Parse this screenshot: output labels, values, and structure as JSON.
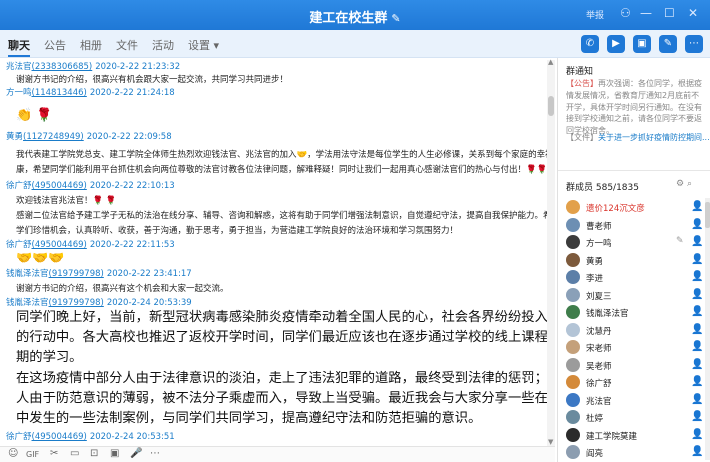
{
  "window": {
    "title": "建工在校生群",
    "edit_icon": "pencil-icon",
    "vip_label": "举报"
  },
  "tabs": [
    "聊天",
    "公告",
    "相册",
    "文件",
    "活动",
    "设置 ▾"
  ],
  "colors": {
    "accent": "#1f78d6",
    "link": "#1a7cc9",
    "red_name": "#d9342b",
    "online": "#3fa84a"
  },
  "messages": [
    {
      "nick": "兆法官",
      "qq": "(2338306685)",
      "time": "2020-2-22 21:23:32",
      "text": "谢谢方书记的介绍，很高兴有机会跟大家一起交流，共同学习共同进步！"
    },
    {
      "nick": "方一鸣",
      "qq": "(114813446)",
      "time": "2020-2-22 21:24:18",
      "emoji": "👏 🌹"
    },
    {
      "nick": "黄勇",
      "qq": "(1127248949)",
      "time": "2020-2-22 22:09:58",
      "lines": [
        "我代表建工学院党总支、建工学院全体师生热烈欢迎钱法官、兆法官的加入🤝，学法用法守法是每位学生的人生必修课，关系到每个家庭的幸福安",
        "康，希望同学们能利用平台抓住机会向两位尊敬的法官讨教各位法律问题，解难释疑！同时让我们一起用真心感谢法官们的热心与付出！🌹🌹🌹"
      ]
    },
    {
      "nick": "徐广舒",
      "qq": "(495004469)",
      "time": "2020-2-22 22:10:13",
      "lines": [
        "欢迎钱法官兆法官！🌹 🌹",
        "感谢二位法官给予建工学子无私的法治在线分享、辅导、咨询和解惑，这将有助于同学们增强法制意识，自觉遵纪守法，提高自我保护能力。希望同",
        "学们珍惜机会，认真聆听、收获，善于沟通，勤于思考，勇于担当，为营造建工学院良好的法治环境和学习氛围努力！"
      ]
    },
    {
      "nick": "徐广舒",
      "qq": "(495004469)",
      "time": "2020-2-22 22:11:53",
      "emoji": "🤝🤝🤝"
    },
    {
      "nick": "钱胤泽法官",
      "qq": "(919799798)",
      "time": "2020-2-22 23:41:17",
      "text": "谢谢方书记的介绍，很高兴有这个机会和大家一起交流。"
    },
    {
      "nick": "钱胤泽法官",
      "qq": "(919799798)",
      "time": "2020-2-24 20:53:39",
      "big_lines": [
        "同学们晚上好，当前，新型冠状病毒感染肺炎疫情牵动着全国人民的心，社会各界纷纷投入抗击疫情",
        "的行动中。各大高校也推迟了返校开学时间，同学们最近应该也在逐步通过学校的线上课程开始新学",
        "期的学习。",
        "在这场疫情中部分人由于法律意识的淡泊，走上了违法犯罪的道路，最终受到法律的惩罚；也有部分",
        "人由于防范意识的薄弱，被不法分子乘虚而入，导致上当受骗。最近我会与大家分享一些在这场疫情",
        "中发生的一些法制案例，与同学们共同学习，提高遵纪守法和防范拒骗的意识。"
      ]
    },
    {
      "nick": "徐广舒",
      "qq": "(495004469)",
      "time": "2020-2-24 20:53:51"
    }
  ],
  "toolbar": [
    "☺",
    "GIF",
    "✂",
    "▭",
    "⊡",
    "▣",
    "🎤",
    "⋯"
  ],
  "sidebar": {
    "notice_title": "群通知",
    "notice_label": "【公告】",
    "notice_text": "再次强调：各位同学，根据疫情发展情况，省教育厅通知2月底前不开学，具体开学时间另行通知。在没有接到学校通知之前，请各位同学不要返回学校宿舍。",
    "file_prefix": "【文件】",
    "file_link": "关于进一步抓好疫情防控期间...",
    "members_title": "群成员 585/1835",
    "members": [
      {
        "name": "遗价124沉文彦",
        "red": true,
        "color": "#e2a04a"
      },
      {
        "name": "曹老师",
        "red": false,
        "color": "#6d8fb3"
      },
      {
        "name": "方一鸣",
        "red": false,
        "color": "#3b3b3b",
        "edit": true
      },
      {
        "name": "黄勇",
        "red": false,
        "color": "#7d5a3c"
      },
      {
        "name": "李进",
        "red": false,
        "color": "#5c7fa8"
      },
      {
        "name": "刘夏三",
        "red": false,
        "color": "#8aa0b8"
      },
      {
        "name": "钱胤泽法官",
        "red": false,
        "color": "#3f7d4b"
      },
      {
        "name": "沈慧丹",
        "red": false,
        "color": "#b3c4d6"
      },
      {
        "name": "宋老师",
        "red": false,
        "color": "#c4a07a"
      },
      {
        "name": "吴老师",
        "red": false,
        "color": "#9b9b9b"
      },
      {
        "name": "徐广舒",
        "red": false,
        "color": "#d48a3a"
      },
      {
        "name": "兆法官",
        "red": false,
        "color": "#3c78c4"
      },
      {
        "name": "杜婷",
        "red": false,
        "color": "#6a8b9e"
      },
      {
        "name": "建工学院莫建",
        "red": false,
        "color": "#2b2b2b"
      },
      {
        "name": "阎亮",
        "red": false,
        "color": "#8c9db0"
      }
    ]
  }
}
